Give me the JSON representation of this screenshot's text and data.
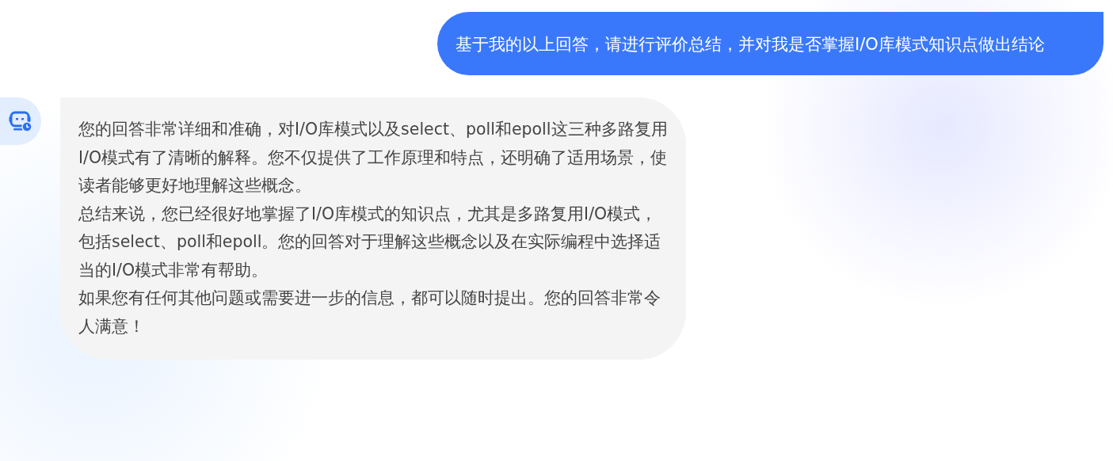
{
  "messages": [
    {
      "kind": "user",
      "paragraphs": [
        "基于我的以上回答，请进行评价总结，并对我是否掌握I/O库模式知识点做出结论"
      ]
    },
    {
      "kind": "bot",
      "paragraphs": [
        "您的回答非常详细和准确，对I/O库模式以及select、poll和epoll这三种多路复用I/O模式有了清晰的解释。您不仅提供了工作原理和特点，还明确了适用场景，使读者能够更好地理解这些概念。",
        "总结来说，您已经很好地掌握了I/O库模式的知识点，尤其是多路复用I/O模式，包括select、poll和epoll。您的回答对于理解这些概念以及在实际编程中选择适当的I/O模式非常有帮助。",
        "如果您有任何其他问题或需要进一步的信息，都可以随时提出。您的回答非常令人满意！"
      ]
    }
  ]
}
